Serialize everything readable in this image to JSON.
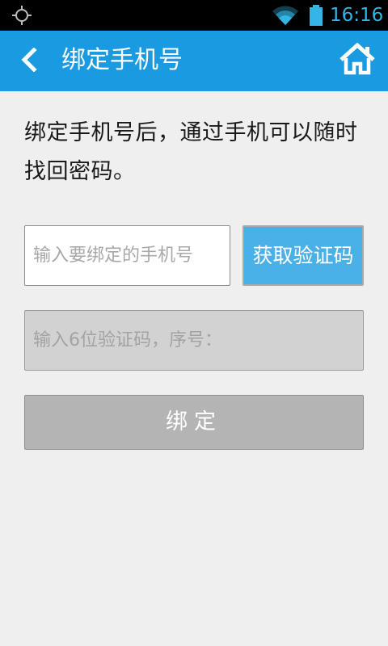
{
  "status_bar": {
    "time": "16:16",
    "icons": [
      "gps-icon",
      "wifi-icon",
      "battery-icon"
    ],
    "clock_color": "#33b5e5"
  },
  "header": {
    "title": "绑定手机号",
    "back_icon": "chevron-left-icon",
    "home_icon": "home-icon",
    "background": "#1a9ae0"
  },
  "main": {
    "description": "绑定手机号后，通过手机可以随时找回密码。",
    "phone_input": {
      "placeholder": "输入要绑定的手机号",
      "value": ""
    },
    "get_code_label": "获取验证码",
    "code_input": {
      "placeholder": "输入6位验证码，序号：",
      "value": ""
    },
    "bind_label": "绑定"
  },
  "colors": {
    "accent": "#1a9ae0",
    "get_code_button": "#4ab0e8",
    "bind_button_disabled": "#b4b4b4",
    "page_background": "#efefef"
  }
}
